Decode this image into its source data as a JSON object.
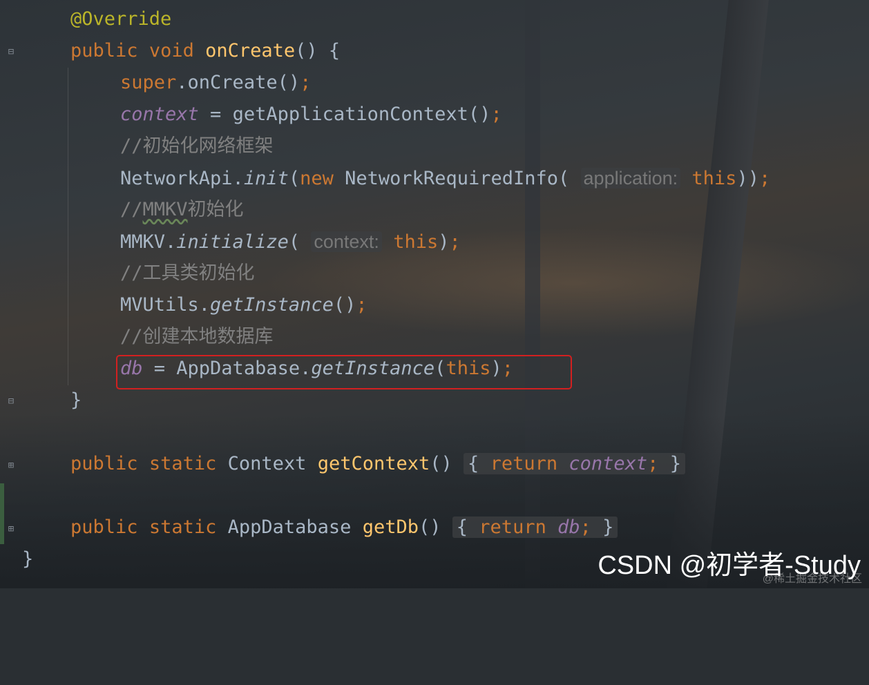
{
  "editor": {
    "lines": {
      "l1": {
        "annotation": "@Override"
      },
      "l2": {
        "kw_public": "public",
        "kw_void": "void",
        "fn_name": "onCreate",
        "rest": "() {"
      },
      "l3": {
        "kw_super": "super",
        "rest1": ".onCreate()",
        "semi": ";"
      },
      "l4": {
        "field": "context",
        "rest": " = getApplicationContext()",
        "semi": ";"
      },
      "l5": {
        "comment": "//初始化网络框架"
      },
      "l6": {
        "p1": "NetworkApi.",
        "method": "init",
        "p2": "(",
        "kw_new": "new",
        "p3": " NetworkRequiredInfo(",
        "hint": "application:",
        "kw_this": "this",
        "p4": "))",
        "semi": ";"
      },
      "l7": {
        "comment_prefix": "//",
        "comment_mmkv": "MMKV",
        "comment_rest": "初始化"
      },
      "l8": {
        "p1": "MMKV.",
        "method": "initialize",
        "p2": "(",
        "hint": "context:",
        "kw_this": "this",
        "p3": ")",
        "semi": ";"
      },
      "l9": {
        "comment": "//工具类初始化"
      },
      "l10": {
        "p1": "MVUtils.",
        "method": "getInstance",
        "p2": "()",
        "semi": ";"
      },
      "l11": {
        "comment": "//创建本地数据库"
      },
      "l12": {
        "field": "db",
        "p1": " = AppDatabase.",
        "method": "getInstance",
        "p2": "(",
        "kw_this": "this",
        "p3": ")",
        "semi": ";"
      },
      "l13": {
        "brace": "}"
      },
      "l14": {
        "kw_public": "public",
        "kw_static": "static",
        "type": "Context",
        "fn_name": "getContext",
        "parens": "()",
        "open": "{",
        "kw_return": "return",
        "field": "context",
        "semi": ";",
        "close": "}"
      },
      "l15": {
        "kw_public": "public",
        "kw_static": "static",
        "type": "AppDatabase",
        "fn_name": "getDb",
        "parens": "()",
        "open": "{",
        "kw_return": "return",
        "field": "db",
        "semi": ";",
        "close": "}"
      },
      "l16": {
        "brace": "}"
      }
    },
    "gutter_icons": [
      "fold-minus-icon",
      "fold-minus-icon",
      "fold-plus-icon",
      "fold-plus-icon"
    ]
  },
  "watermark": {
    "main": "CSDN @初学者-Study",
    "sub": "@稀土掘金技术社区"
  },
  "colors": {
    "keyword": "#cc7832",
    "annotation": "#bbb529",
    "function": "#ffc66d",
    "text": "#a9b7c6",
    "field": "#9876aa",
    "comment": "#808080",
    "highlight_box": "#d32020"
  }
}
